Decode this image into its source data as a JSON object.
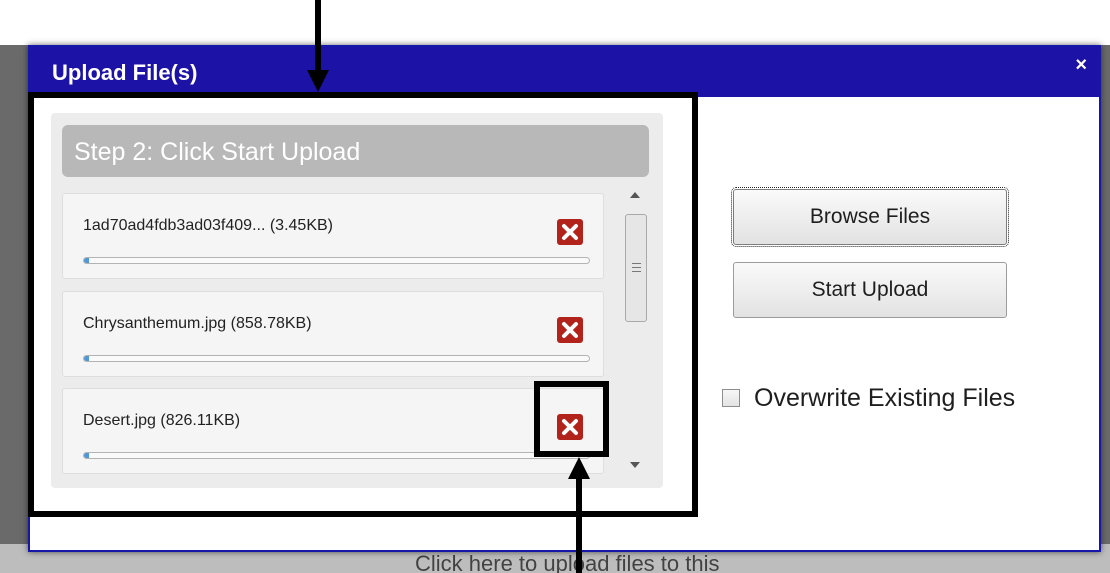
{
  "modal": {
    "title": "Upload File(s)",
    "close_glyph": "×"
  },
  "background": {
    "footer_text": "Click here to upload files to this"
  },
  "step": {
    "label": "Step 2: Click Start Upload"
  },
  "files": [
    {
      "name": "1ad70ad4fdb3ad03f409... (3.45KB)",
      "progress": 0.01
    },
    {
      "name": "Chrysanthemum.jpg (858.78KB)",
      "progress": 0.01
    },
    {
      "name": "Desert.jpg (826.11KB)",
      "progress": 0.01
    }
  ],
  "buttons": {
    "browse": "Browse Files",
    "start": "Start Upload"
  },
  "options": {
    "overwrite_label": "Overwrite Existing Files",
    "overwrite_checked": false
  },
  "colors": {
    "header_bg": "#1c13a6",
    "remove_icon_bg": "#b2241b",
    "progress_fill": "#4f97d6",
    "annotation": "#000000"
  },
  "icons": {
    "remove": "remove-file-icon",
    "close": "close-icon"
  }
}
